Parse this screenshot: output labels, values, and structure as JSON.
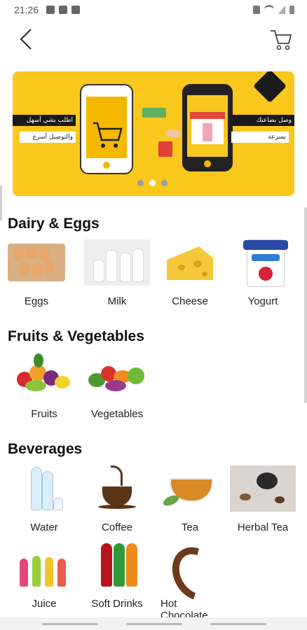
{
  "status_bar": {
    "time": "21:26"
  },
  "header": {
    "back_icon": "chevron-left-icon",
    "cart_icon": "cart-icon"
  },
  "banner": {
    "left_texts": [
      "اطلب بشي أسهل",
      "والتوصيل أسرع"
    ],
    "right_texts": [
      "وصل بضاعتك",
      "بسرعة"
    ],
    "page_count": 3,
    "active_page": 1
  },
  "sections": [
    {
      "title": "Dairy & Eggs",
      "items": [
        {
          "label": "Eggs",
          "icon": "eggs-image"
        },
        {
          "label": "Milk",
          "icon": "milk-image"
        },
        {
          "label": "Cheese",
          "icon": "cheese-image"
        },
        {
          "label": "Yogurt",
          "icon": "yogurt-image"
        }
      ]
    },
    {
      "title": "Fruits & Vegetables",
      "items": [
        {
          "label": "Fruits",
          "icon": "fruits-image"
        },
        {
          "label": "Vegetables",
          "icon": "vegetables-image"
        }
      ]
    },
    {
      "title": "Beverages",
      "items": [
        {
          "label": "Water",
          "icon": "water-image"
        },
        {
          "label": "Coffee",
          "icon": "coffee-image"
        },
        {
          "label": "Tea",
          "icon": "tea-image"
        },
        {
          "label": "Herbal Tea",
          "icon": "herbal-tea-image"
        },
        {
          "label": "Juice",
          "icon": "juice-image"
        },
        {
          "label": "Soft Drinks",
          "icon": "soft-drinks-image"
        },
        {
          "label": "Hot Chocolate",
          "icon": "hot-chocolate-image"
        }
      ]
    }
  ],
  "colors": {
    "brand_yellow": "#fac71c",
    "dark": "#1a1a1a"
  }
}
